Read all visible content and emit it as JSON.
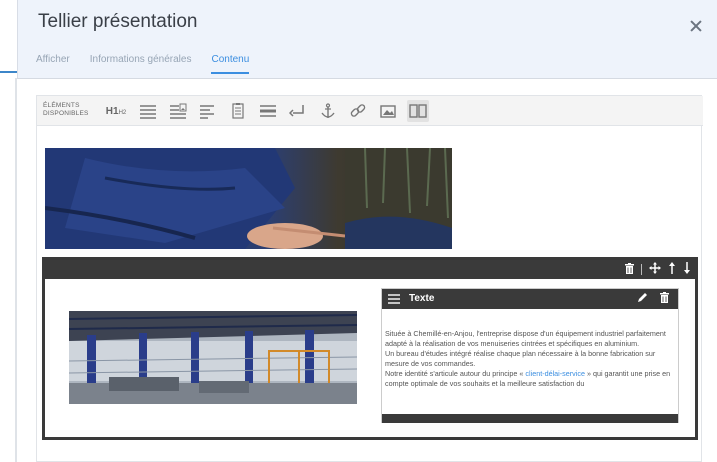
{
  "header": {
    "title": "Tellier présentation",
    "tabs": [
      {
        "label": "Afficher",
        "active": false
      },
      {
        "label": "Informations générales",
        "active": false
      },
      {
        "label": "Contenu",
        "active": true
      }
    ]
  },
  "toolbar": {
    "label_line1": "ÉLÉMENTS",
    "label_line2": "DISPONIBLES",
    "h1_label": "H1",
    "h2_label": "H2",
    "icons": [
      "heading-icon",
      "paragraph-icon",
      "text-image-icon",
      "align-left-icon",
      "form-icon",
      "separator-icon",
      "return-icon",
      "anchor-icon",
      "link-icon",
      "image-icon",
      "columns-icon"
    ]
  },
  "block": {
    "panel_title": "Texte",
    "paragraph1": "Située à Chemillé-en-Anjou, l'entreprise dispose d'un équipement industriel parfaitement adapté à la réalisation de vos menuiseries cintrées et spécifiques en aluminium.",
    "paragraph2": "Un bureau d'études intégré réalise chaque plan nécessaire à la bonne fabrication sur mesure de vos commandes.",
    "paragraph3_before": "Notre identité s'articule autour du principe « ",
    "paragraph3_link": "client-délai-service",
    "paragraph3_after": " » qui garantit une prise en compte optimale de vos souhaits et la meilleure satisfaction du"
  },
  "colors": {
    "accent": "#3b8ee0",
    "header_bg": "#eef3fb",
    "block_border": "#3a3a3a"
  }
}
